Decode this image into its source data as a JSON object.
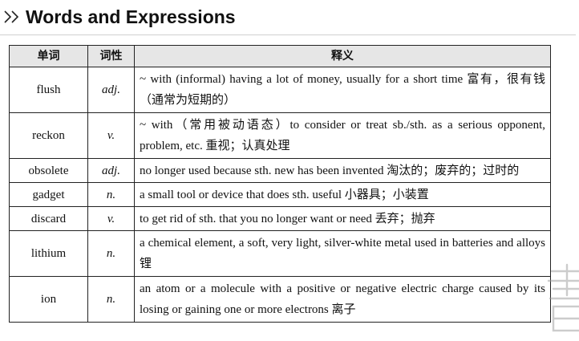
{
  "section": {
    "title": "Words and Expressions",
    "chevron_icon": "double-chevron-right-icon"
  },
  "table": {
    "headers": {
      "word": "单词",
      "pos": "词性",
      "definition": "释义"
    },
    "rows": [
      {
        "word": "flush",
        "pos": "adj.",
        "definition": "~ with (informal) having a lot of money, usually for a short time 富有，很有钱（通常为短期的）"
      },
      {
        "word": "reckon",
        "pos": "v.",
        "definition": "~ with（常用被动语态）to consider or treat sb./sth. as a serious opponent, problem, etc. 重视；认真处理"
      },
      {
        "word": "obsolete",
        "pos": "adj.",
        "definition": "no longer used because sth. new has been invented 淘汰的；废弃的；过时的"
      },
      {
        "word": "gadget",
        "pos": "n.",
        "definition": "a small tool or device that does sth. useful 小器具；小装置"
      },
      {
        "word": "discard",
        "pos": "v.",
        "definition": "to get rid of sth. that you no longer want or need 丢弃；抛弃"
      },
      {
        "word": "lithium",
        "pos": "n.",
        "definition": "a chemical element, a soft, very light, silver-white metal used in batteries and alloys 锂"
      },
      {
        "word": "ion",
        "pos": "n.",
        "definition": "an atom or a molecule with a positive or negative electric charge caused by its losing or gaining one or more electrons 离子"
      }
    ]
  }
}
